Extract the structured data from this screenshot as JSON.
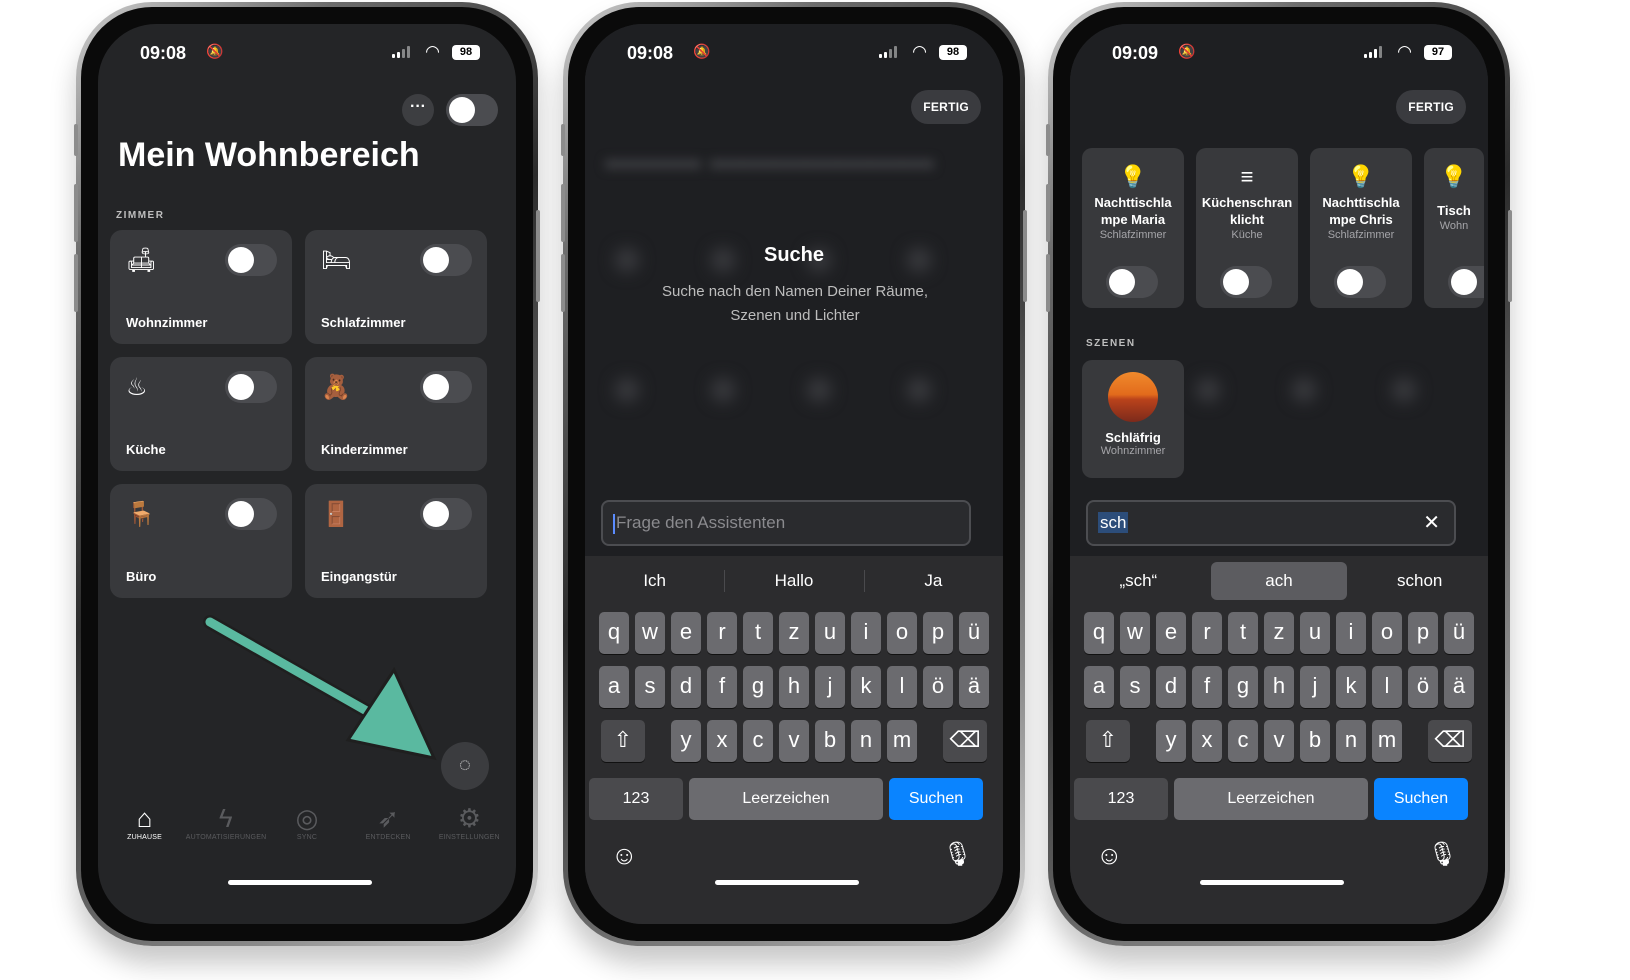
{
  "phone1": {
    "status": {
      "time": "09:08",
      "battery": "98"
    },
    "title": "Mein Wohnbereich",
    "section_label": "ZIMMER",
    "rooms": [
      {
        "name": "Wohnzimmer",
        "icon": "sofa-icon",
        "on": false
      },
      {
        "name": "Schlafzimmer",
        "icon": "bed-icon",
        "on": false
      },
      {
        "name": "Küche",
        "icon": "pot-icon",
        "on": false
      },
      {
        "name": "Kinderzimmer",
        "icon": "teddy-icon",
        "on": false
      },
      {
        "name": "Büro",
        "icon": "office-chair-icon",
        "on": false
      },
      {
        "name": "Eingangstür",
        "icon": "door-icon",
        "on": false
      }
    ],
    "tabs": [
      {
        "label": "ZUHAUSE",
        "icon": "home-icon",
        "active": true
      },
      {
        "label": "AUTOMATISIERUNGEN",
        "icon": "bolt-icon",
        "active": false
      },
      {
        "label": "SYNC",
        "icon": "sync-icon",
        "active": false
      },
      {
        "label": "ENTDECKEN",
        "icon": "rocket-icon",
        "active": false
      },
      {
        "label": "EINSTELLUNGEN",
        "icon": "gear-icon",
        "active": false
      }
    ],
    "annotation_arrow_color": "#5ab9a0"
  },
  "phone2": {
    "status": {
      "time": "09:08",
      "battery": "98"
    },
    "done_label": "FERTIG",
    "search_heading": "Suche",
    "search_sub": "Suche nach den Namen Deiner Räume, Szenen und Lichter",
    "input_placeholder": "Frage den Assistenten",
    "suggestions": [
      "Ich",
      "Hallo",
      "Ja"
    ]
  },
  "phone3": {
    "status": {
      "time": "09:09",
      "battery": "97"
    },
    "done_label": "FERTIG",
    "accessories": [
      {
        "name": "Nachttischla mpe Maria",
        "room": "Schlafzimmer",
        "icon": "bulb-icon"
      },
      {
        "name": "Küchenschran klicht",
        "room": "Küche",
        "icon": "lightstrip-icon"
      },
      {
        "name": "Nachttischla mpe Chris",
        "room": "Schlafzimmer",
        "icon": "bulb-icon"
      },
      {
        "name": "Tisch",
        "room": "Wohn",
        "icon": "bulb-icon"
      }
    ],
    "scenes_label": "SZENEN",
    "scene": {
      "name": "Schläfrig",
      "room": "Wohnzimmer"
    },
    "input_value": "sch",
    "suggestions": [
      "„sch“",
      "ach",
      "schon"
    ]
  },
  "keyboard": {
    "row1": [
      "q",
      "w",
      "e",
      "r",
      "t",
      "z",
      "u",
      "i",
      "o",
      "p",
      "ü"
    ],
    "row2": [
      "a",
      "s",
      "d",
      "f",
      "g",
      "h",
      "j",
      "k",
      "l",
      "ö",
      "ä"
    ],
    "row3": [
      "y",
      "x",
      "c",
      "v",
      "b",
      "n",
      "m"
    ],
    "numbers_label": "123",
    "space_label": "Leerzeichen",
    "go_label": "Suchen"
  }
}
